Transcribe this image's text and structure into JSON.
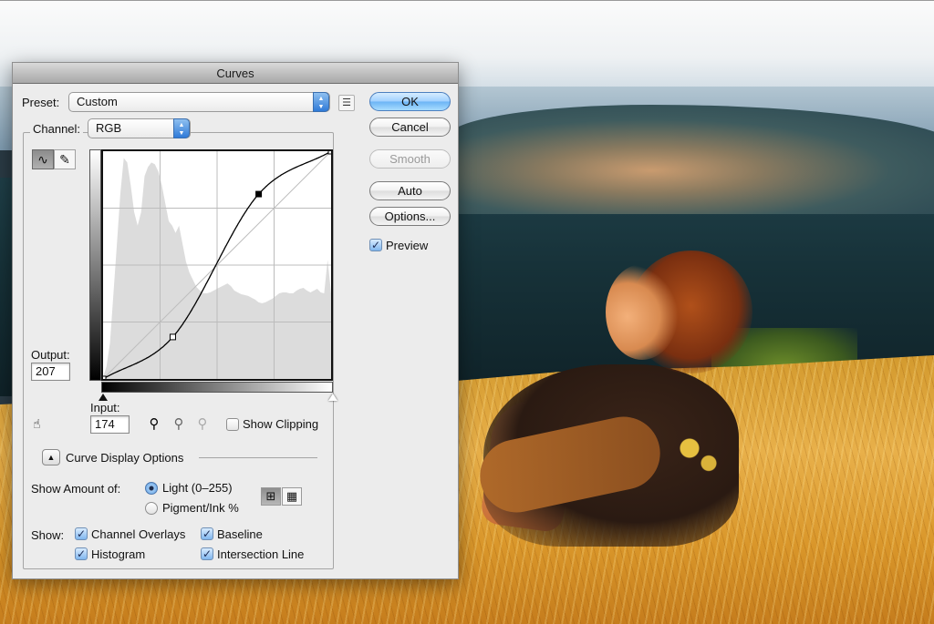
{
  "window": {
    "title": "Curves"
  },
  "preset": {
    "label": "Preset:",
    "value": "Custom"
  },
  "channel": {
    "label": "Channel:",
    "value": "RGB"
  },
  "buttons": {
    "ok": "OK",
    "cancel": "Cancel",
    "smooth": "Smooth",
    "auto": "Auto",
    "options": "Options..."
  },
  "preview": {
    "label": "Preview",
    "checked": true
  },
  "tools": [
    {
      "name": "curve-point-tool",
      "icon": "∿",
      "active": true
    },
    {
      "name": "pencil-tool",
      "icon": "✎",
      "active": false
    }
  ],
  "output": {
    "label": "Output:",
    "value": "207"
  },
  "input": {
    "label": "Input:",
    "value": "174"
  },
  "eyedroppers": [
    {
      "name": "black-point-eyedropper",
      "tone": "black"
    },
    {
      "name": "gray-point-eyedropper",
      "tone": "gray"
    },
    {
      "name": "white-point-eyedropper",
      "tone": "white"
    }
  ],
  "show_clipping": {
    "label": "Show Clipping",
    "checked": false
  },
  "curve_display_options": {
    "label": "Curve Display Options",
    "expanded": true
  },
  "show_amount": {
    "label": "Show Amount of:",
    "options": [
      {
        "label": "Light  (0–255)",
        "selected": true
      },
      {
        "label": "Pigment/Ink %",
        "selected": false
      }
    ]
  },
  "grid_size": {
    "options": [
      "simple-grid",
      "detailed-grid"
    ],
    "selected": "simple-grid"
  },
  "show": {
    "label": "Show:",
    "items": [
      {
        "label": "Channel Overlays",
        "checked": true
      },
      {
        "label": "Baseline",
        "checked": true
      },
      {
        "label": "Histogram",
        "checked": true
      },
      {
        "label": "Intersection Line",
        "checked": true
      }
    ]
  },
  "curve": {
    "range": [
      0,
      255
    ],
    "points": [
      [
        0,
        0
      ],
      [
        78,
        47
      ],
      [
        174,
        207
      ],
      [
        255,
        255
      ]
    ],
    "selected_point": 2,
    "histogram": [
      2,
      14,
      40,
      95,
      150,
      205,
      245,
      240,
      215,
      185,
      170,
      185,
      225,
      235,
      240,
      238,
      230,
      215,
      195,
      175,
      170,
      162,
      170,
      150,
      130,
      118,
      110,
      102,
      98,
      95,
      95,
      96,
      98,
      100,
      102,
      104,
      106,
      103,
      98,
      96,
      94,
      93,
      92,
      90,
      88,
      85,
      84,
      85,
      87,
      89,
      92,
      95,
      96,
      96,
      95,
      95,
      98,
      100,
      101,
      98,
      96,
      98,
      100,
      96,
      95,
      132,
      95
    ],
    "colors": {
      "curve": "#000000",
      "baseline": "#bdbdbd",
      "grid": "#bcbcbc",
      "histogram": "#dcdcdc"
    }
  }
}
